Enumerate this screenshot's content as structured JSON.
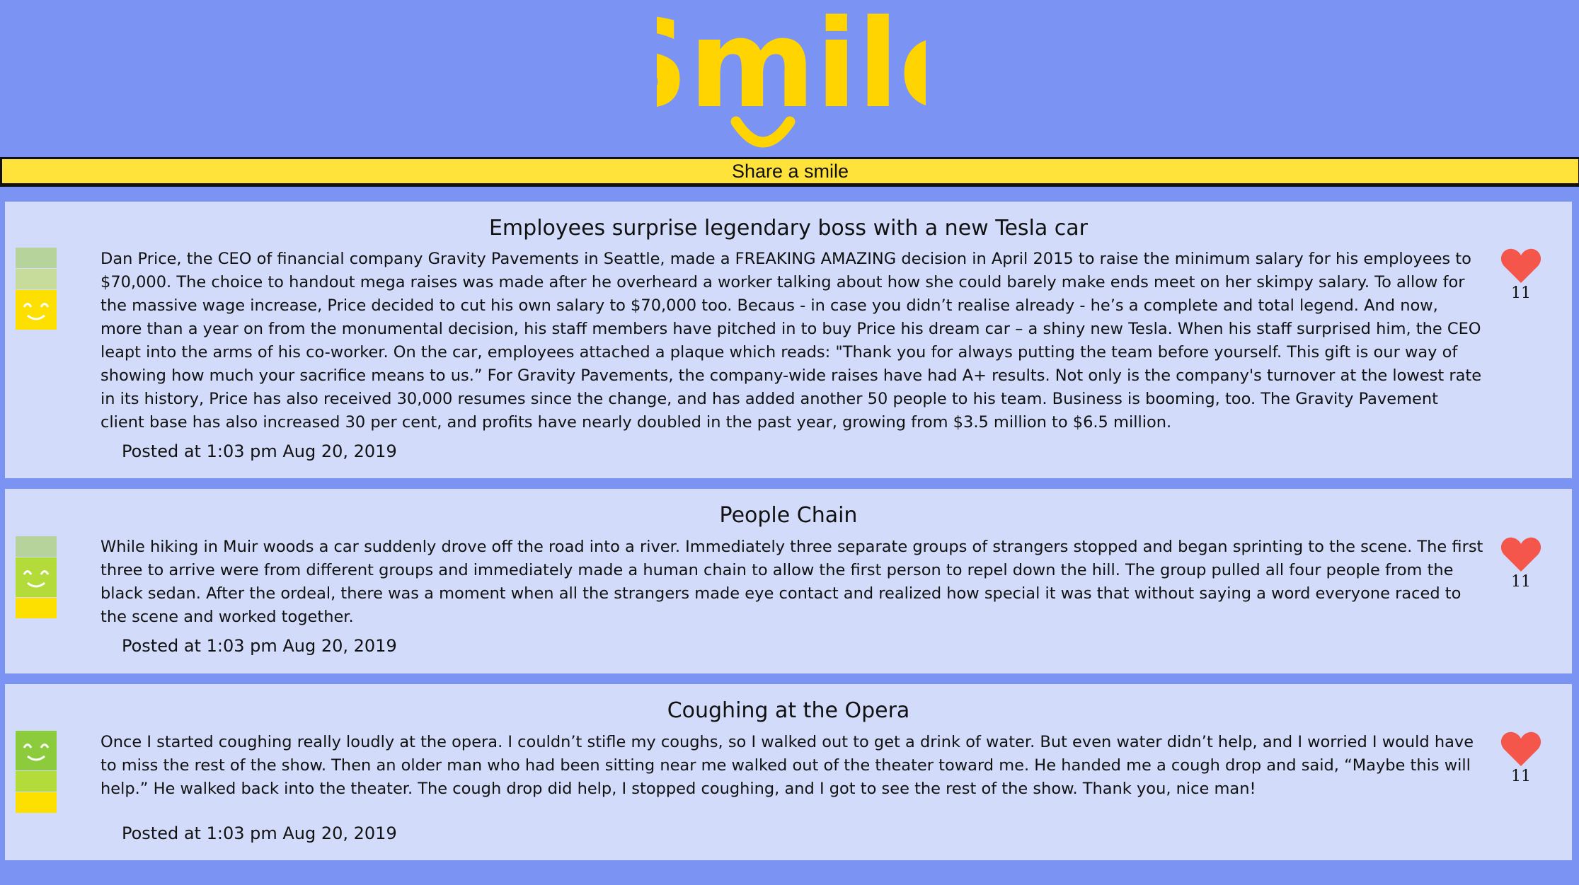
{
  "header": {
    "logo_text": "Smile",
    "share_label": "Share a smile"
  },
  "colors": {
    "background": "#7b93f2",
    "logo": "#ffd400",
    "share_bar": "#ffe33a",
    "card": "#d2dcfa",
    "heart": "#f4564b",
    "meter_light_green": "#b5d39a",
    "meter_pale_green": "#c7dc9a",
    "meter_lime": "#b3dc3a",
    "meter_green": "#8ccc3c",
    "meter_yellow": "#fde000"
  },
  "posts": [
    {
      "title": "Employees surprise legendary boss with a new Tesla car",
      "body": "Dan Price, the CEO of financial company Gravity Pavements in Seattle, made a FREAKING AMAZING decision in April 2015 to raise the minimum salary for his employees to $70,000. The choice to handout mega raises was made after he overheard a worker talking about how she could barely make ends meet on her skimpy salary. To allow for the massive wage increase, Price decided to cut his own salary to $70,000 too. Becaus - in case you didn’t realise already - he’s a complete and total legend. And now, more than a year on from the monumental decision, his staff members have pitched in to buy Price his dream car – a shiny new Tesla. When his staff surprised him, the CEO leapt into the arms of his co-worker. On the car, employees attached a plaque which reads: \"Thank you for always putting the team before yourself. This gift is our way of showing how much your sacrifice means to us.” For Gravity Pavements, the company-wide raises have had A+ results. Not only is the company's turnover at the lowest rate in its history, Price has also received 30,000 resumes since the change, and has added another 50 people to his team. Business is booming, too. The Gravity Pavement client base has also increased 30 per cent, and profits have nearly doubled in the past year, growing from $3.5 million to $6.5 million.",
      "posted": "Posted at 1:03 pm Aug 20, 2019",
      "likes": "11",
      "smile_level": 3
    },
    {
      "title": "People Chain",
      "body": "While hiking in Muir woods a car suddenly drove off the road into a river. Immediately three separate groups of strangers stopped and began sprinting to the scene. The first three to arrive were from different groups and immediately made a human chain to allow the first person to repel down the hill. The group pulled all four people from the black sedan. After the ordeal, there was a moment when all the strangers made eye contact and realized how special it was that without saying a word everyone raced to the scene and worked together.",
      "posted": "Posted at 1:03 pm Aug 20, 2019",
      "likes": "11",
      "smile_level": 2
    },
    {
      "title": "Coughing at the Opera",
      "body": "Once I started coughing really loudly at the opera. I couldn’t stifle my coughs, so I walked out to get a drink of water. But even water didn’t help, and I worried I would have to miss the rest of the show. Then an older man who had been sitting near me walked out of the theater toward me. He handed me a cough drop and said, “Maybe this will help.” He walked back into the theater. The cough drop did help, I stopped coughing, and I got to see the rest of the show. Thank you, nice man!",
      "posted": "Posted at 1:03 pm Aug 20, 2019",
      "likes": "11",
      "smile_level": 1
    }
  ]
}
